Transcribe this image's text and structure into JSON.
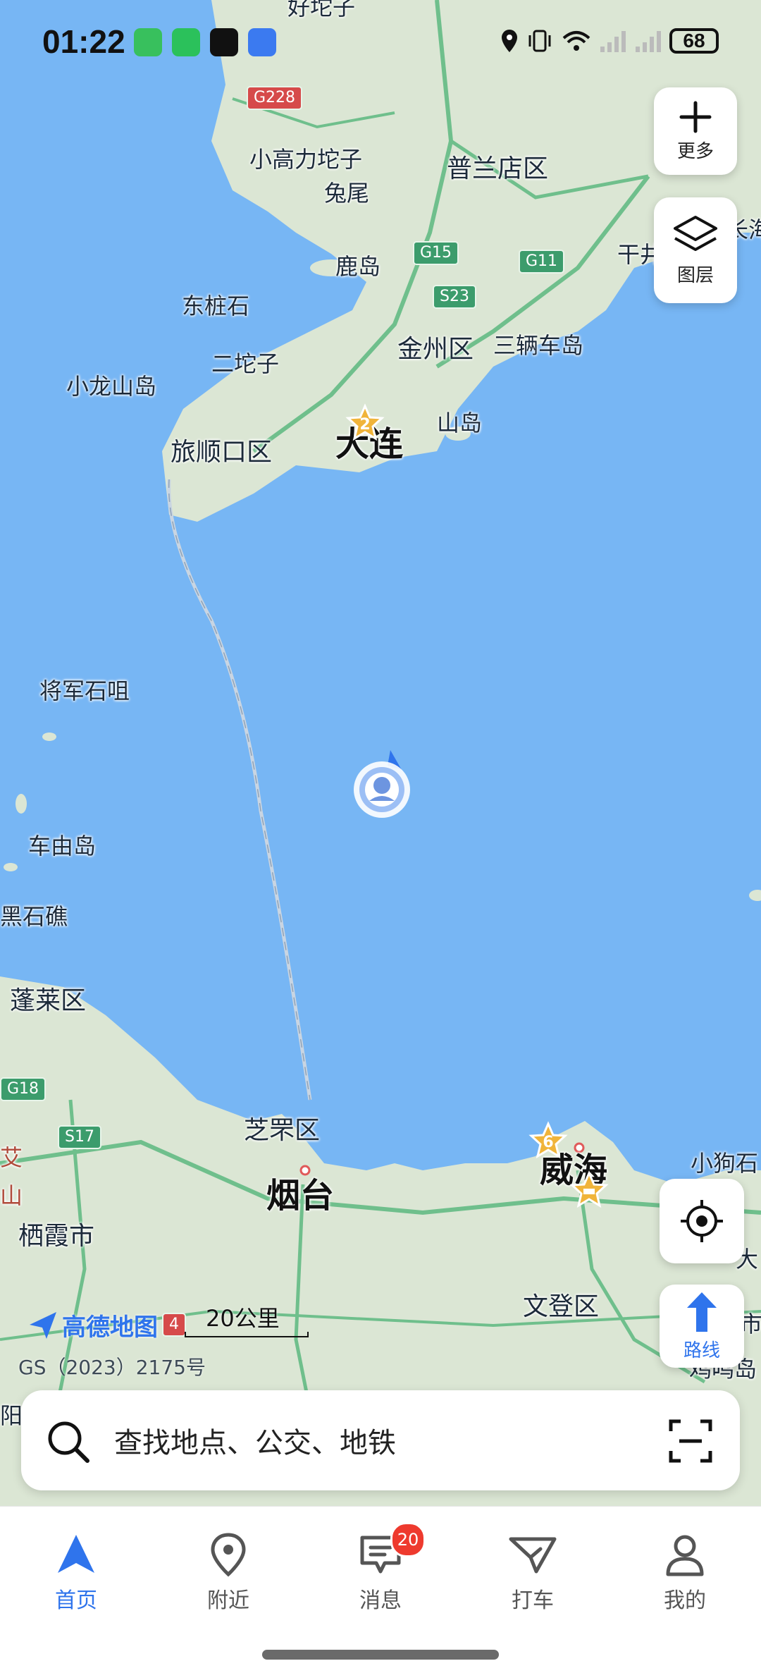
{
  "status_bar": {
    "time": "01:22",
    "battery": "68",
    "app_icons": [
      "xiaomi-icon",
      "wechat-icon",
      "douyin-icon",
      "upload-icon"
    ]
  },
  "map": {
    "labels": {
      "top_partial": "好坨子",
      "xiaogaoli": "小高力坨子",
      "tuwei": "兔尾",
      "pulandian": "普兰店区",
      "ganjing": "干井",
      "changhai": "长海",
      "ludao": "鹿岛",
      "dongzhuangshi": "东桩石",
      "ertuozi": "二坨子",
      "jinzhou": "金州区",
      "sanliangchedao": "三辆车岛",
      "xiaolongshan": "小龙山岛",
      "lvshunkou": "旅顺口区",
      "dalian": "大连",
      "shandao": "山岛",
      "jiangjunshi": "将军石咀",
      "cheyou": "车由岛",
      "heishijiao": "黑石礁",
      "penglai": "蓬莱区",
      "zhifu": "芝罘区",
      "yantai": "烟台",
      "qixia": "栖霞市",
      "weihai": "威海",
      "xiaogoushi": "小狗石",
      "wendeng": "文登区",
      "ai": "艾",
      "shan": "山",
      "right_edge_1": "大",
      "right_edge_2": "市",
      "jiming": "鸡鸣岛",
      "left_bottom": "阳"
    },
    "roads": {
      "g228": "G228",
      "g15": "G15",
      "g11": "G11",
      "s23": "S23",
      "g18": "G18",
      "s17": "S17",
      "g4": "4"
    },
    "poi_counts": {
      "dalian_cluster": "2",
      "weihai_cluster": "6"
    },
    "brand": "高德地图",
    "scale": "20公里",
    "gs_code": "GS（2023）2175号"
  },
  "controls": {
    "more_label": "更多",
    "layers_label": "图层",
    "route_label": "路线"
  },
  "search": {
    "placeholder": "查找地点、公交、地铁"
  },
  "nav": {
    "home": "首页",
    "nearby": "附近",
    "messages": "消息",
    "messages_badge": "20",
    "taxi": "打车",
    "mine": "我的"
  },
  "colors": {
    "sea": "#77b6f4",
    "land": "#dbe6d4",
    "accent": "#2f74ec",
    "highway": "#3c9c6c",
    "badge": "#ee3a2e"
  }
}
